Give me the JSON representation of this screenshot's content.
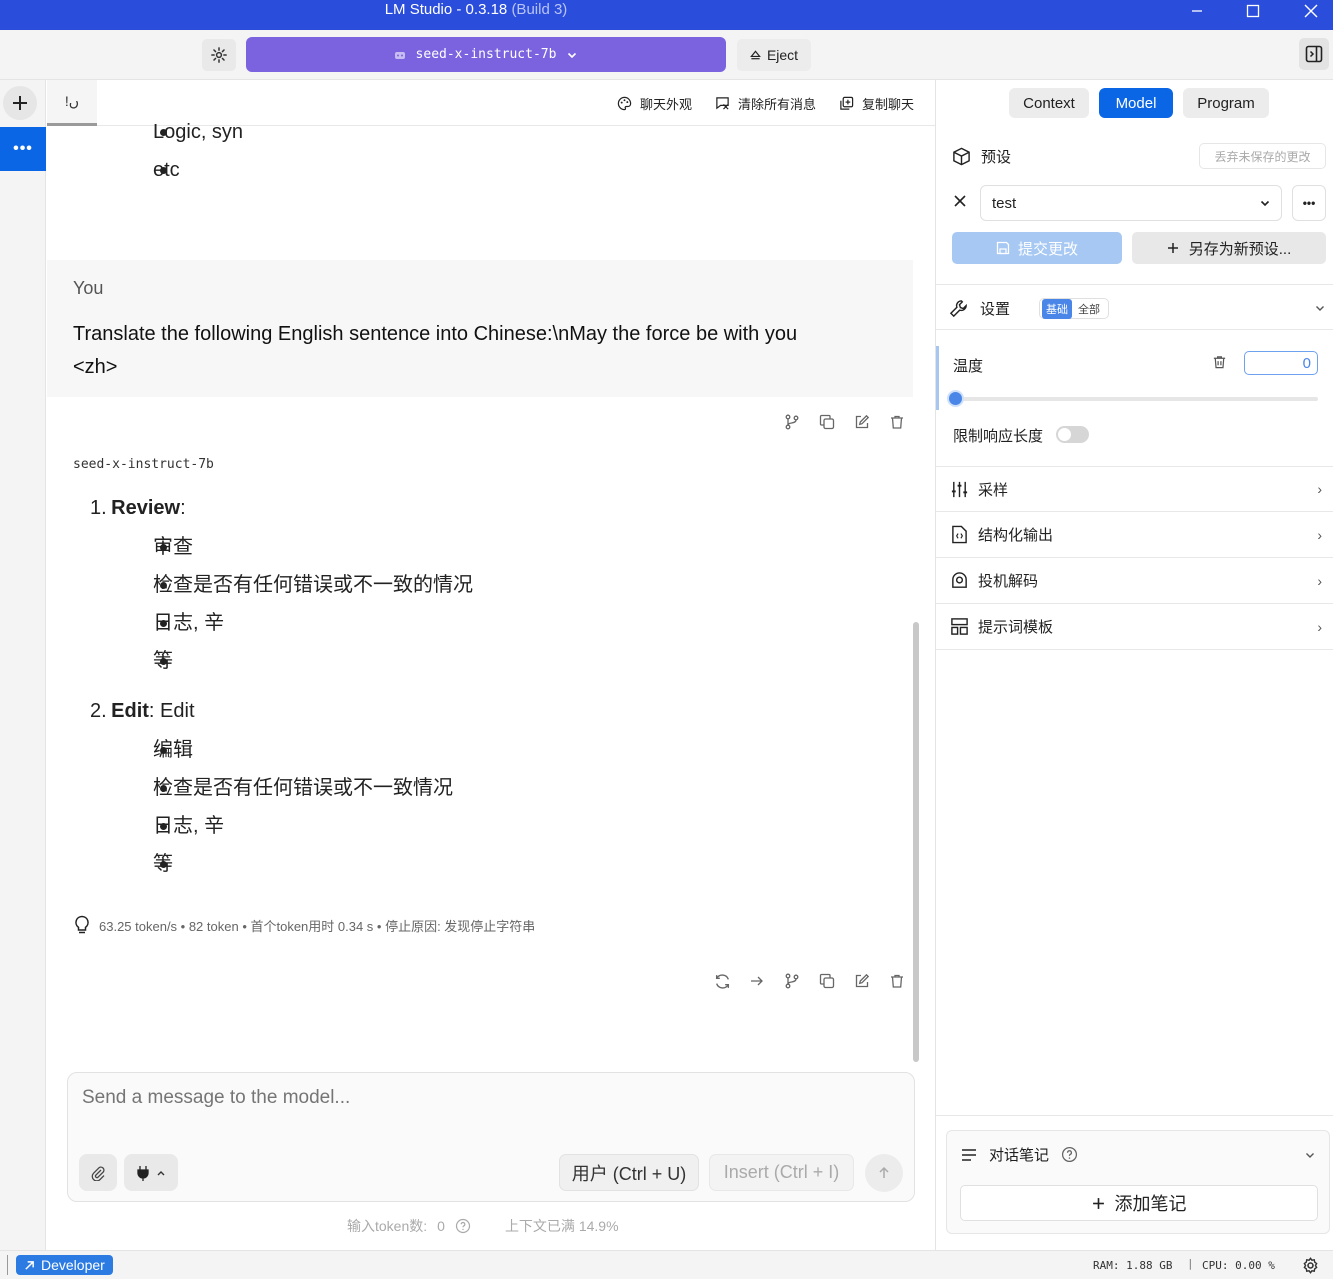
{
  "window": {
    "title": "LM Studio - 0.3.18",
    "build": "(Build 3)"
  },
  "topbar": {
    "model_name": "seed-x-instruct-7b",
    "eject_label": "Eject"
  },
  "chat_tab": {
    "tab_label": "!ں",
    "actions": [
      "聊天外观",
      "清除所有消息",
      "复制聊天"
    ]
  },
  "messages": {
    "prev_tail_items": [
      "Logic, syn",
      "etc"
    ],
    "user": {
      "author": "You",
      "text_line1": "Translate the following English sentence into Chinese:\\nMay the force be with you",
      "text_line2": "<zh>"
    },
    "assistant": {
      "model": "seed-x-instruct-7b",
      "list": [
        {
          "num": "1.",
          "bold": "Review",
          "suffix": ":",
          "items": [
            "审查",
            "检查是否有任何错误或不一致的情况",
            "日志, 辛",
            "等"
          ]
        },
        {
          "num": "2.",
          "bold": "Edit",
          "suffix": ": Edit",
          "items": [
            "编辑",
            "检查是否有任何错误或不一致情况",
            "日志, 辛",
            "等"
          ]
        }
      ],
      "stats": "63.25 token/s • 82 token • 首个token用时 0.34 s • 停止原因: 发现停止字符串"
    }
  },
  "input": {
    "placeholder": "Send a message to the model...",
    "role_button": "用户 (Ctrl + U)",
    "insert_button": "Insert (Ctrl + I)",
    "token_count_label": "输入token数:",
    "token_count": "0",
    "context_full": "上下文已满 14.9%"
  },
  "right_panel": {
    "tabs": [
      "Context",
      "Model",
      "Program"
    ],
    "active_tab": "Model",
    "preset": {
      "label": "预设",
      "discard": "丢弃未保存的更改",
      "selected": "test",
      "commit": "提交更改",
      "save_as": "另存为新预设..."
    },
    "settings": {
      "label": "设置",
      "mode_basic": "基础",
      "mode_all": "全部",
      "temperature_label": "温度",
      "temperature_value": "0",
      "temperature_level": 0,
      "limit_length_label": "限制响应长度",
      "limit_length_on": false
    },
    "sections": [
      "采样",
      "结构化输出",
      "投机解码",
      "提示词模板"
    ],
    "notes": {
      "label": "对话笔记",
      "add": "添加笔记"
    }
  },
  "statusbar": {
    "mode": "Developer",
    "ram": "RAM: 1.88 GB",
    "cpu": "CPU: 0.00 %"
  },
  "colors": {
    "titlebar": "#2b4ddb",
    "accent": "#0a66e4",
    "model_selector": "#7b63e0"
  }
}
